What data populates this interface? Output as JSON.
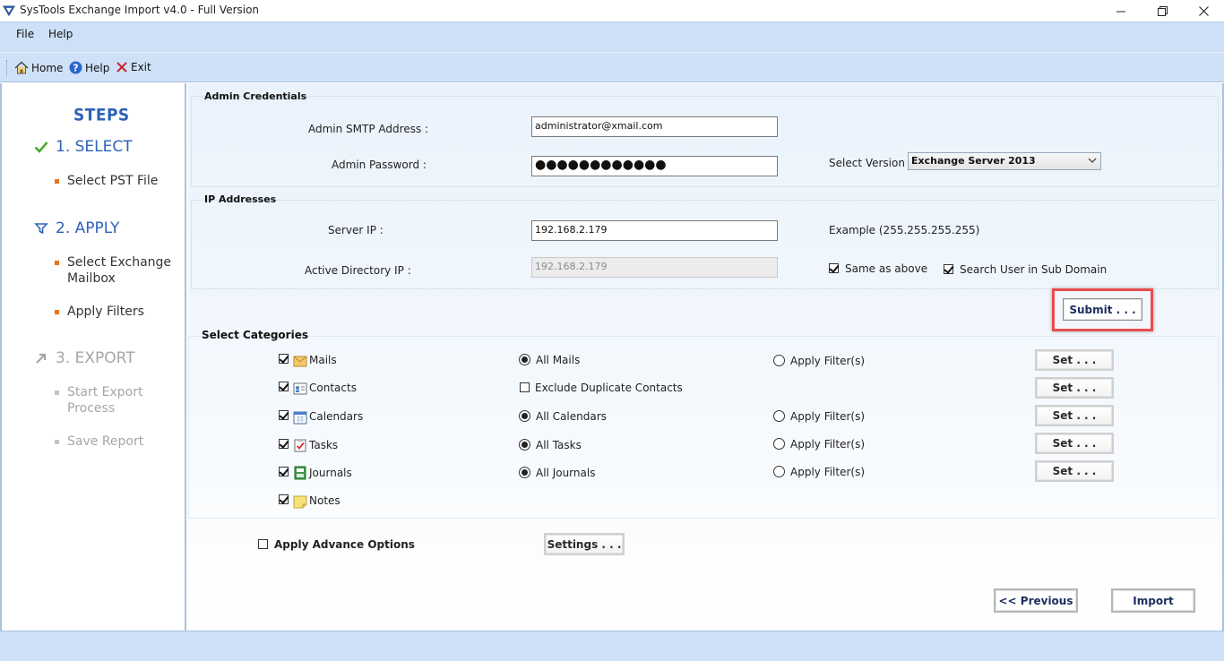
{
  "window": {
    "title": "SysTools Exchange Import v4.0 - Full Version"
  },
  "menu": {
    "file": "File",
    "help": "Help"
  },
  "toolbar": {
    "home": "Home",
    "help": "Help",
    "exit": "Exit"
  },
  "steps": {
    "title": "STEPS",
    "step1": {
      "label": "1. SELECT",
      "items": [
        "Select PST File"
      ]
    },
    "step2": {
      "label": "2. APPLY",
      "items": [
        "Select Exchange",
        "Mailbox",
        "Apply Filters"
      ]
    },
    "step3": {
      "label": "3. EXPORT",
      "items": [
        "Start Export",
        "Process",
        "Save Report"
      ]
    }
  },
  "admin": {
    "group_title": "Admin Credentials",
    "smtp_label": "Admin SMTP Address :",
    "smtp_value": "administrator@xmail.com",
    "password_label": "Admin Password :",
    "password_value": "●●●●●●●●●●●●",
    "version_label": "Select Version",
    "version_value": "Exchange Server 2013"
  },
  "ip": {
    "group_title": "IP Addresses",
    "server_label": "Server IP :",
    "server_value": "192.168.2.179",
    "example": "Example (255.255.255.255)",
    "ad_label": "Active Directory IP :",
    "ad_value": "192.168.2.179",
    "same_as_above": "Same as above",
    "search_sub_domain": "Search User in Sub Domain"
  },
  "submit_label": "Submit . . .",
  "categories": {
    "title": "Select Categories",
    "rows": [
      {
        "name": "Mails",
        "option": "All Mails",
        "filter": "Apply Filter(s)",
        "set": "Set . . ."
      },
      {
        "name": "Contacts",
        "option": "Exclude Duplicate Contacts",
        "set": "Set . . ."
      },
      {
        "name": "Calendars",
        "option": "All Calendars",
        "filter": "Apply Filter(s)",
        "set": "Set . . ."
      },
      {
        "name": "Tasks",
        "option": "All Tasks",
        "filter": "Apply Filter(s)",
        "set": "Set . . ."
      },
      {
        "name": "Journals",
        "option": "All Journals",
        "filter": "Apply Filter(s)",
        "set": "Set . . ."
      },
      {
        "name": "Notes"
      }
    ]
  },
  "advance": {
    "label": "Apply Advance Options",
    "settings": "Settings . . ."
  },
  "nav": {
    "previous": "<< Previous",
    "import": "Import"
  },
  "colors": {
    "accent_blue": "#2d62b8",
    "highlight_red": "#e84d4d",
    "bar_blue": "#cde0f7"
  }
}
